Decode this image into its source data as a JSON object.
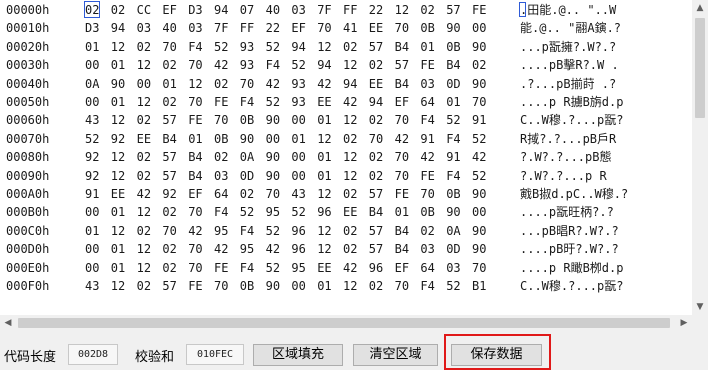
{
  "hex_view": {
    "rows": [
      {
        "addr": "00000h",
        "bytes": [
          "02",
          "02",
          "CC",
          "EF",
          "D3",
          "94",
          "07",
          "40",
          "03",
          "7F",
          "FF",
          "22",
          "12",
          "02",
          "57",
          "FE"
        ],
        "ascii": ".田能.@..  \"..W"
      },
      {
        "addr": "00010h",
        "bytes": [
          "D3",
          "94",
          "03",
          "40",
          "03",
          "7F",
          "FF",
          "22",
          "EF",
          "70",
          "41",
          "EE",
          "70",
          "0B",
          "90",
          "00"
        ],
        "ascii": "能.@..  \"翮A鏔.?"
      },
      {
        "addr": "00020h",
        "bytes": [
          "01",
          "12",
          "02",
          "70",
          "F4",
          "52",
          "93",
          "52",
          "94",
          "12",
          "02",
          "57",
          "B4",
          "01",
          "0B",
          "90"
        ],
        "ascii": "...p翫擁?.W?.?"
      },
      {
        "addr": "00030h",
        "bytes": [
          "00",
          "01",
          "12",
          "02",
          "70",
          "42",
          "93",
          "F4",
          "52",
          "94",
          "12",
          "02",
          "57",
          "FE",
          "B4",
          "02"
        ],
        "ascii": "....pB擊R?.W  ."
      },
      {
        "addr": "00040h",
        "bytes": [
          "0A",
          "90",
          "00",
          "01",
          "12",
          "02",
          "70",
          "42",
          "93",
          "42",
          "94",
          "EE",
          "B4",
          "03",
          "0D",
          "90"
        ],
        "ascii": ".?...pB揃莳 .?"
      },
      {
        "addr": "00050h",
        "bytes": [
          "00",
          "01",
          "12",
          "02",
          "70",
          "FE",
          "F4",
          "52",
          "93",
          "EE",
          "42",
          "94",
          "EF",
          "64",
          "01",
          "70"
        ],
        "ascii": "....p  R擄B旃d.p"
      },
      {
        "addr": "00060h",
        "bytes": [
          "43",
          "12",
          "02",
          "57",
          "FE",
          "70",
          "0B",
          "90",
          "00",
          "01",
          "12",
          "02",
          "70",
          "F4",
          "52",
          "91"
        ],
        "ascii": "C..W穆.?...p翫?"
      },
      {
        "addr": "00070h",
        "bytes": [
          "52",
          "92",
          "EE",
          "B4",
          "01",
          "0B",
          "90",
          "00",
          "01",
          "12",
          "02",
          "70",
          "42",
          "91",
          "F4",
          "52"
        ],
        "ascii": "R掝?.?...pB戶R"
      },
      {
        "addr": "00080h",
        "bytes": [
          "92",
          "12",
          "02",
          "57",
          "B4",
          "02",
          "0A",
          "90",
          "00",
          "01",
          "12",
          "02",
          "70",
          "42",
          "91",
          "42"
        ],
        "ascii": "?.W?.?...pB態"
      },
      {
        "addr": "00090h",
        "bytes": [
          "92",
          "12",
          "02",
          "57",
          "B4",
          "03",
          "0D",
          "90",
          "00",
          "01",
          "12",
          "02",
          "70",
          "FE",
          "F4",
          "52"
        ],
        "ascii": "?.W?.?...p  R"
      },
      {
        "addr": "000A0h",
        "bytes": [
          "91",
          "EE",
          "42",
          "92",
          "EF",
          "64",
          "02",
          "70",
          "43",
          "12",
          "02",
          "57",
          "FE",
          "70",
          "0B",
          "90"
        ],
        "ascii": "戭B掓d.pC..W穆.?"
      },
      {
        "addr": "000B0h",
        "bytes": [
          "00",
          "01",
          "12",
          "02",
          "70",
          "F4",
          "52",
          "95",
          "52",
          "96",
          "EE",
          "B4",
          "01",
          "0B",
          "90",
          "00"
        ],
        "ascii": "....p翫旺柄?.?"
      },
      {
        "addr": "000C0h",
        "bytes": [
          "01",
          "12",
          "02",
          "70",
          "42",
          "95",
          "F4",
          "52",
          "96",
          "12",
          "02",
          "57",
          "B4",
          "02",
          "0A",
          "90"
        ],
        "ascii": "...pB晿R?.W?.?"
      },
      {
        "addr": "000D0h",
        "bytes": [
          "00",
          "01",
          "12",
          "02",
          "70",
          "42",
          "95",
          "42",
          "96",
          "12",
          "02",
          "57",
          "B4",
          "03",
          "0D",
          "90"
        ],
        "ascii": "....pB旴?.W?.?"
      },
      {
        "addr": "000E0h",
        "bytes": [
          "00",
          "01",
          "12",
          "02",
          "70",
          "FE",
          "F4",
          "52",
          "95",
          "EE",
          "42",
          "96",
          "EF",
          "64",
          "03",
          "70"
        ],
        "ascii": "....p  R瞰B栁d.p"
      },
      {
        "addr": "000F0h",
        "bytes": [
          "43",
          "12",
          "02",
          "57",
          "FE",
          "70",
          "0B",
          "90",
          "00",
          "01",
          "12",
          "02",
          "70",
          "F4",
          "52",
          "B1"
        ],
        "ascii": "C..W穆.?...p翫?"
      }
    ]
  },
  "scrollbar": {
    "up_icon": "▲",
    "down_icon": "▼",
    "left_icon": "◀",
    "right_icon": "▶"
  },
  "toolbar": {
    "code_length_label": "代码长度",
    "code_length_value": "002D8",
    "checksum_label": "校验和",
    "checksum_value": "010FEC",
    "fill_button": "区域填充",
    "clear_button": "清空区域",
    "save_button": "保存数据"
  },
  "colors": {
    "highlight": "#e01919",
    "caret": "#2f5bd6"
  }
}
